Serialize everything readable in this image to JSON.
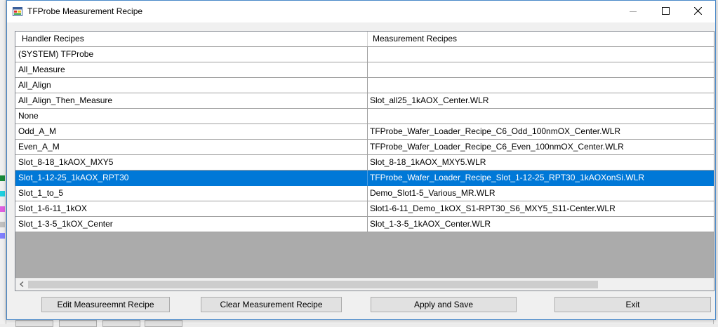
{
  "window": {
    "title": "TFProbe Measurement Recipe"
  },
  "grid": {
    "columns": [
      "Handler Recipes",
      "Measurement Recipes"
    ],
    "rows": [
      {
        "handler": "(SYSTEM) TFProbe",
        "measurement": "",
        "selected": false
      },
      {
        "handler": "All_Measure",
        "measurement": "",
        "selected": false
      },
      {
        "handler": "All_Align",
        "measurement": "",
        "selected": false
      },
      {
        "handler": "All_Align_Then_Measure",
        "measurement": "Slot_all25_1kAOX_Center.WLR",
        "selected": false
      },
      {
        "handler": "None",
        "measurement": "",
        "selected": false
      },
      {
        "handler": "Odd_A_M",
        "measurement": "TFProbe_Wafer_Loader_Recipe_C6_Odd_100nmOX_Center.WLR",
        "selected": false
      },
      {
        "handler": "Even_A_M",
        "measurement": "TFProbe_Wafer_Loader_Recipe_C6_Even_100nmOX_Center.WLR",
        "selected": false
      },
      {
        "handler": "Slot_8-18_1kAOX_MXY5",
        "measurement": "Slot_8-18_1kAOX_MXY5.WLR",
        "selected": false
      },
      {
        "handler": "Slot_1-12-25_1kAOX_RPT30",
        "measurement": "TFProbe_Wafer_Loader_Recipe_Slot_1-12-25_RPT30_1kAOXonSi.WLR",
        "selected": true
      },
      {
        "handler": "Slot_1_to_5",
        "measurement": "Demo_Slot1-5_Various_MR.WLR",
        "selected": false
      },
      {
        "handler": "Slot_1-6-11_1kOX",
        "measurement": "Slot1-6-11_Demo_1kOX_S1-RPT30_S6_MXY5_S11-Center.WLR",
        "selected": false
      },
      {
        "handler": "Slot_1-3-5_1kOX_Center",
        "measurement": "Slot_1-3-5_1kAOX_Center.WLR",
        "selected": false
      }
    ]
  },
  "buttons": {
    "edit": "Edit Measureemnt Recipe",
    "clear": "Clear Measurement Recipe",
    "apply": "Apply and Save",
    "exit": "Exit"
  },
  "colors": {
    "selection": "#0078d7",
    "grid_empty_area": "#ababab",
    "window_border": "#4a89c9"
  },
  "icons": {
    "app": "app-window-icon",
    "minimize": "minimize-icon",
    "maximize": "maximize-icon",
    "close": "close-icon",
    "scroll_left": "chevron-left-icon"
  }
}
